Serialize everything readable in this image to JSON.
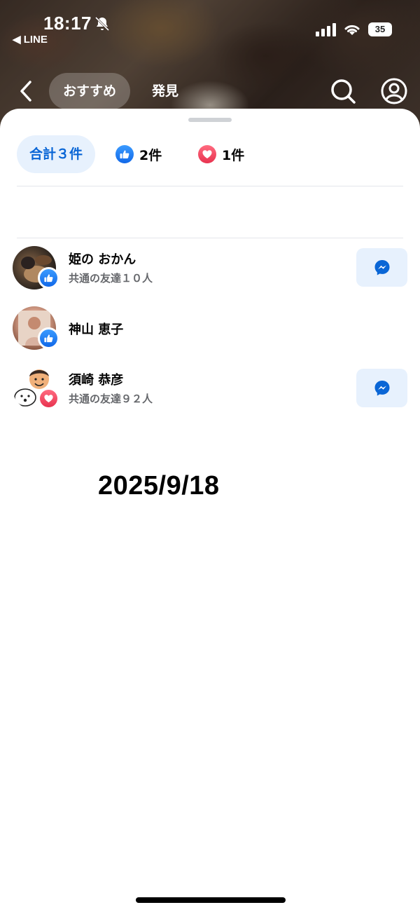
{
  "status_bar": {
    "time": "18:17",
    "back_app": "◀ LINE",
    "battery": "35"
  },
  "nav": {
    "tabs": [
      {
        "label": "おすすめ",
        "active": true
      },
      {
        "label": "発見",
        "active": false
      }
    ]
  },
  "reactions": {
    "filters": {
      "all_label": "合計３件",
      "like_count": "2件",
      "love_count": "1件"
    },
    "people": [
      {
        "name": "姫の おかん",
        "mutual": "共通の友達１０人",
        "reaction": "like",
        "message_button": true
      },
      {
        "name": "神山 恵子",
        "mutual": "",
        "reaction": "like",
        "message_button": false
      },
      {
        "name": "須崎 恭彦",
        "mutual": "共通の友達９２人",
        "reaction": "love",
        "message_button": true
      }
    ]
  },
  "overlay_date": "2025/9/18",
  "icons": {
    "like": "thumbs-up-icon",
    "love": "heart-icon",
    "message": "messenger-icon",
    "search": "search-icon",
    "profile": "profile-icon",
    "back": "chevron-left-icon",
    "bell_muted": "bell-slash-icon"
  },
  "colors": {
    "accent_blue": "#0a66d6",
    "accent_bg": "#e7f1fd",
    "like_blue": "#1877f2",
    "love_red": "#f0405c"
  }
}
